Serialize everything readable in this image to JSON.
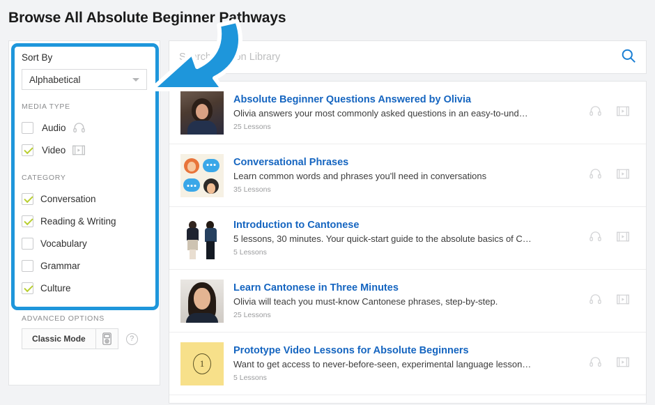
{
  "header": {
    "title": "Browse All Absolute Beginner Pathways"
  },
  "sidebar": {
    "sort": {
      "label": "Sort By",
      "selected": "Alphabetical",
      "caret_icon": "chevron-down-icon"
    },
    "media_type": {
      "label": "MEDIA TYPE",
      "options": [
        {
          "label": "Audio",
          "checked": false,
          "icon": "headphones-icon"
        },
        {
          "label": "Video",
          "checked": true,
          "icon": "film-icon"
        }
      ]
    },
    "category": {
      "label": "CATEGORY",
      "options": [
        {
          "label": "Conversation",
          "checked": true
        },
        {
          "label": "Reading & Writing",
          "checked": true
        },
        {
          "label": "Vocabulary",
          "checked": false
        },
        {
          "label": "Grammar",
          "checked": false
        },
        {
          "label": "Culture",
          "checked": true
        }
      ]
    },
    "advanced": {
      "label": "ADVANCED OPTIONS",
      "classic_mode_label": "Classic Mode",
      "device_icon": "ipod-icon",
      "help_icon": "question-mark-icon",
      "help_glyph": "?"
    }
  },
  "search": {
    "placeholder": "Search Lesson Library",
    "value": "",
    "icon": "search-icon"
  },
  "results": {
    "audio_icon": "headphones-icon",
    "video_icon": "film-icon",
    "items": [
      {
        "title": "Absolute Beginner Questions Answered by Olivia",
        "description": "Olivia answers your most commonly asked questions in an easy-to-und…",
        "lessons": "25 Lessons",
        "thumb": "olivia-portrait"
      },
      {
        "title": "Conversational Phrases",
        "description": "Learn common words and phrases you'll need in conversations",
        "lessons": "35 Lessons",
        "thumb": "avatars-speech-bubbles"
      },
      {
        "title": "Introduction to Cantonese",
        "description": "5 lessons, 30 minutes. Your quick-start guide to the absolute basics of C…",
        "lessons": "5 Lessons",
        "thumb": "two-people-standing"
      },
      {
        "title": "Learn Cantonese in Three Minutes",
        "description": "Olivia will teach you must-know Cantonese phrases, step-by-step.",
        "lessons": "25 Lessons",
        "thumb": "woman-portrait"
      },
      {
        "title": "Prototype Video Lessons for Absolute Beginners",
        "description": "Want to get access to never-before-seen, experimental language lesson…",
        "lessons": "5 Lessons",
        "thumb": "yellow-number-one",
        "thumb_number": "1"
      }
    ]
  },
  "annotation": {
    "arrow_icon": "curved-arrow-pointing-left",
    "arrow_color": "#1e96db"
  },
  "colors": {
    "accent_blue": "#1e96db",
    "link_blue": "#1565c0",
    "checkmark_green": "#b9cf32",
    "page_bg": "#f2f3f5",
    "highlight_yellow": "#f7e08a"
  }
}
